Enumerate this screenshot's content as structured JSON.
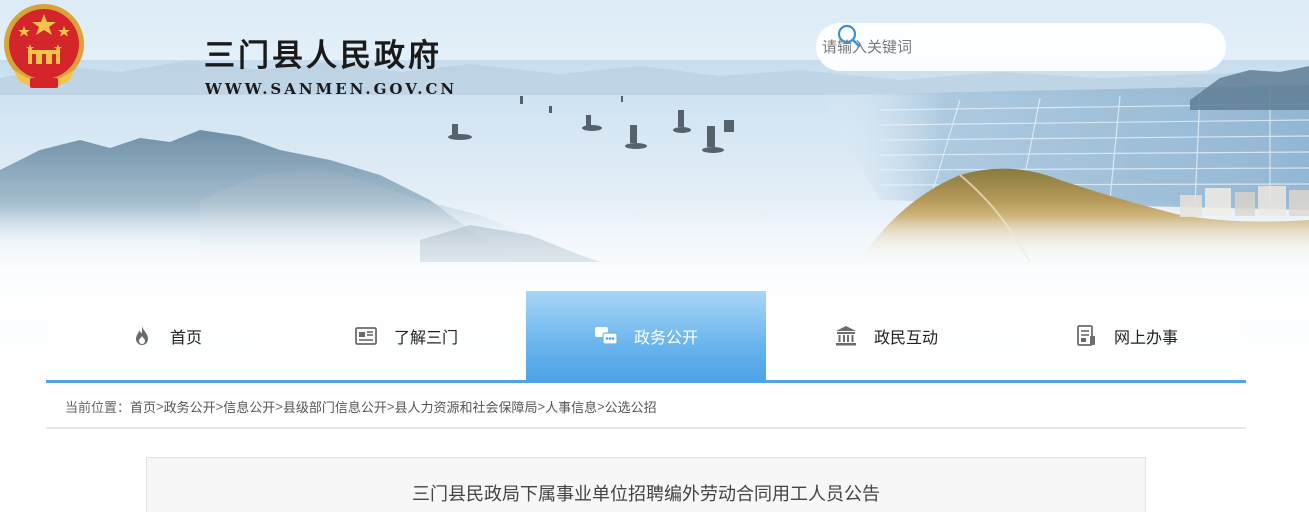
{
  "header": {
    "site_title": "三门县人民政府",
    "site_url": "WWW.SANMEN.GOV.CN",
    "emblem_icon": "national-emblem-icon"
  },
  "search": {
    "placeholder": "请输入关键词",
    "value": "",
    "icon": "search-icon"
  },
  "nav": {
    "items": [
      {
        "label": "首页",
        "icon": "fire-icon",
        "active": false
      },
      {
        "label": "了解三门",
        "icon": "newspaper-icon",
        "active": false
      },
      {
        "label": "政务公开",
        "icon": "chat-bubbles-icon",
        "active": true
      },
      {
        "label": "政民互动",
        "icon": "building-icon",
        "active": false
      },
      {
        "label": "网上办事",
        "icon": "document-icon",
        "active": false
      }
    ],
    "accent_color": "#4fa3e6"
  },
  "breadcrumb": {
    "prefix": "当前位置：",
    "items": [
      "首页",
      "政务公开",
      "信息公开",
      "县级部门信息公开",
      "县人力资源和社会保障局",
      "人事信息",
      "公选公招"
    ],
    "separator": ">"
  },
  "article": {
    "title": "三门县民政局下属事业单位招聘编外劳动合同用工人员公告"
  }
}
